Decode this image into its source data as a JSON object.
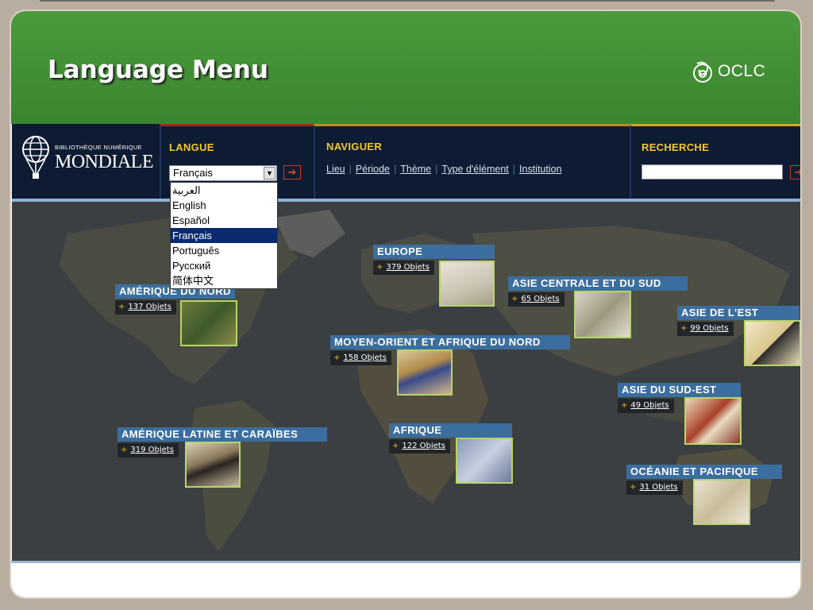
{
  "slide": {
    "title": "Language Menu",
    "logo_text": "OCLC"
  },
  "wdl": {
    "logo_small": "BIBLIOTHÈQUE NUMÉRIQUE",
    "logo_big": "MONDIALE",
    "langue_title": "LANGUE",
    "selected_language": "Français",
    "languages": [
      "العربية",
      "English",
      "Español",
      "Français",
      "Português",
      "Русский",
      "简体中文"
    ],
    "naviguer_title": "NAVIGUER",
    "nav_links": [
      "Lieu",
      "Période",
      "Thème",
      "Type d'élément",
      "Institution"
    ],
    "recherche_title": "RECHERCHE",
    "search_value": "",
    "go_glyph": "➔"
  },
  "regions": [
    {
      "name": "AMÉRIQUE DU NORD",
      "count": "137 Objets"
    },
    {
      "name": "EUROPE",
      "count": "379 Objets"
    },
    {
      "name": "ASIE CENTRALE ET DU SUD",
      "count": "65 Objets"
    },
    {
      "name": "ASIE DE L'EST",
      "count": "99 Objets"
    },
    {
      "name": "MOYEN-ORIENT ET AFRIQUE DU NORD",
      "count": "158 Objets"
    },
    {
      "name": "ASIE DU SUD-EST",
      "count": "49 Objets"
    },
    {
      "name": "AMÉRIQUE LATINE ET CARAÏBES",
      "count": "319 Objets"
    },
    {
      "name": "AFRIQUE",
      "count": "122 Objets"
    },
    {
      "name": "OCÉANIE ET PACIFIQUE",
      "count": "31 Objets"
    }
  ],
  "colors": {
    "title_green": "#3b8530",
    "header_navy": "#0e1c33",
    "region_blue": "#3b6e9e",
    "accent_yellow": "#f2c733"
  }
}
